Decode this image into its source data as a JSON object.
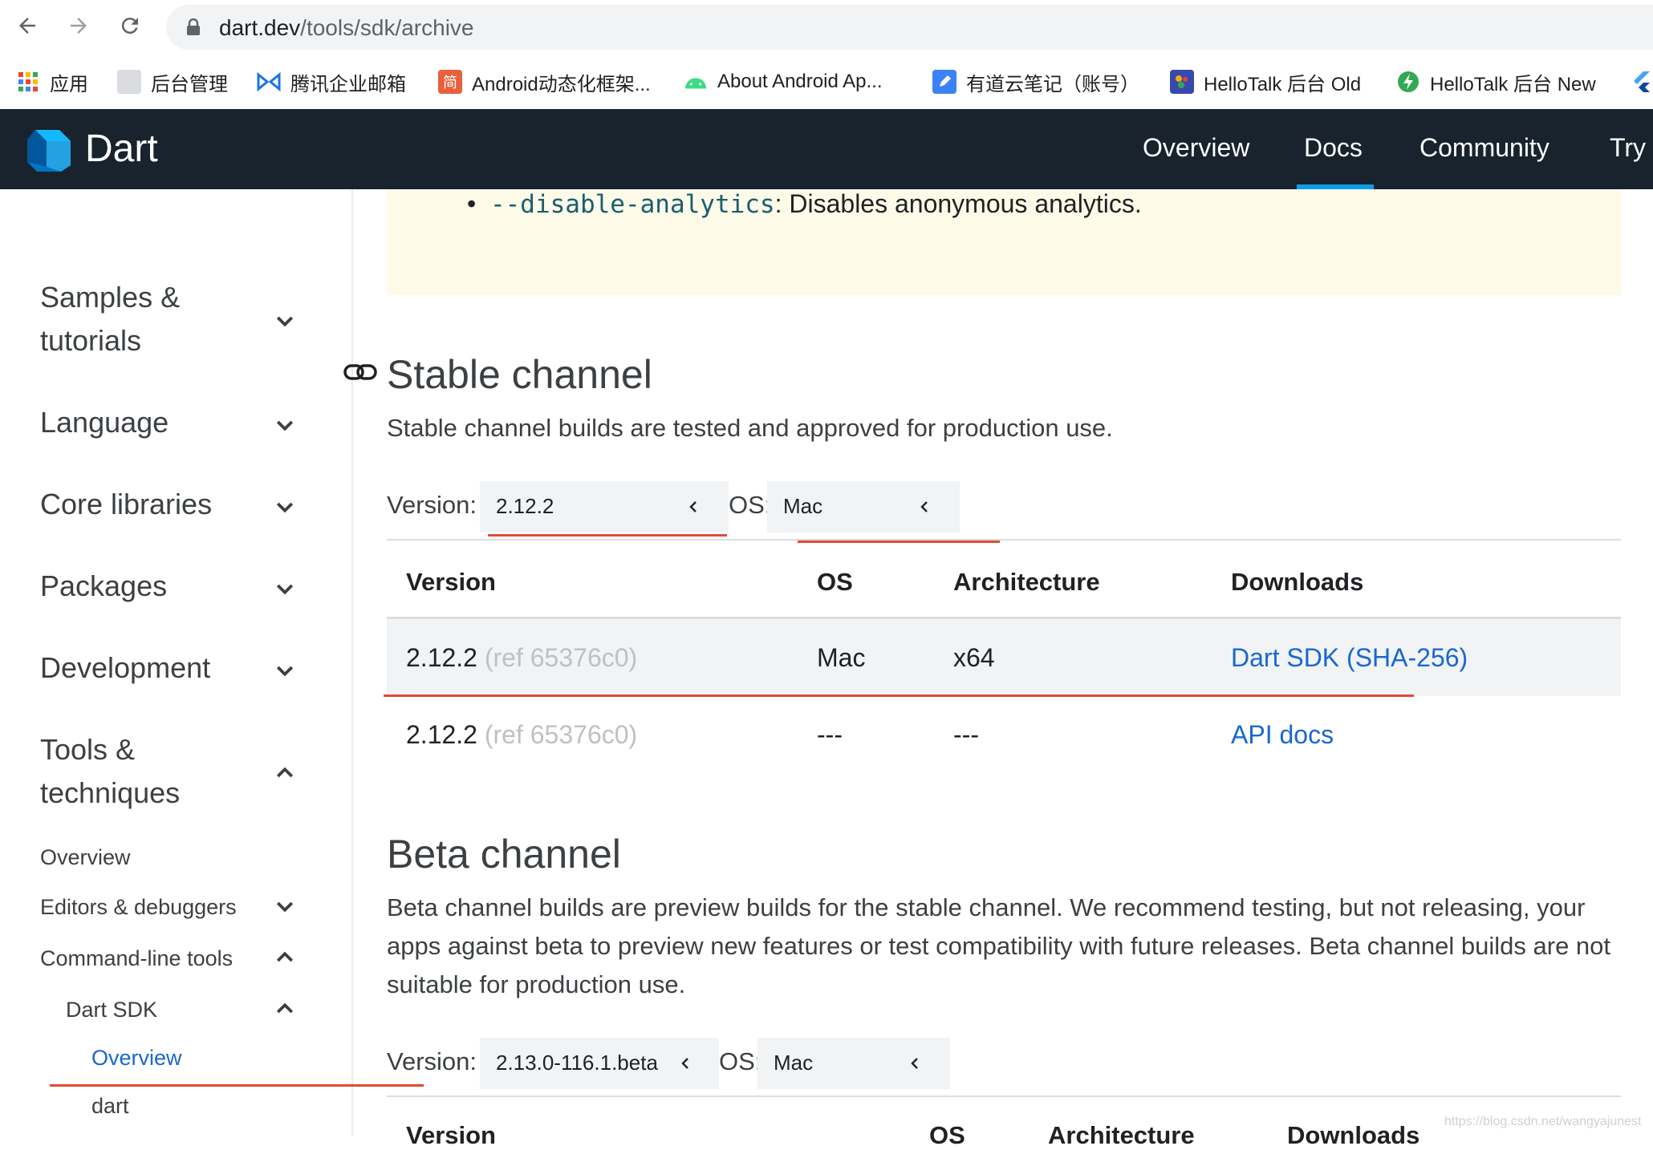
{
  "browser": {
    "url_host": "dart.dev",
    "url_path": "/tools/sdk/archive"
  },
  "bookmarks": [
    {
      "label": "应用",
      "icon": "apps-grid-icon",
      "color": "#ea4335"
    },
    {
      "label": "后台管理",
      "icon": "admin-icon",
      "color": "#9aa0a6"
    },
    {
      "label": "腾讯企业邮箱",
      "icon": "tencent-mail-icon",
      "color": "#1a73e8"
    },
    {
      "label": "Android动态化框架...",
      "icon": "jian-icon",
      "glyph": "简",
      "color": "#e8613c"
    },
    {
      "label": "About Android Ap...",
      "icon": "android-icon",
      "color": "#3ddc84"
    },
    {
      "label": "有道云笔记（账号）",
      "icon": "youdao-icon",
      "color": "#3b82f6"
    },
    {
      "label": "HelloTalk 后台 Old",
      "icon": "hellotalk-old-icon",
      "color": "#3949ab"
    },
    {
      "label": "HelloTalk 后台 New",
      "icon": "hellotalk-new-icon",
      "color": "#34a853"
    }
  ],
  "header": {
    "brand": "Dart",
    "nav": [
      "Overview",
      "Docs",
      "Community",
      "Try"
    ],
    "active_nav": "Docs"
  },
  "sidebar": {
    "sections": [
      {
        "label": "Samples & tutorials",
        "expanded": false
      },
      {
        "label": "Language",
        "expanded": false
      },
      {
        "label": "Core libraries",
        "expanded": false
      },
      {
        "label": "Packages",
        "expanded": false
      },
      {
        "label": "Development",
        "expanded": false
      },
      {
        "label": "Tools & techniques",
        "expanded": true
      }
    ],
    "items": [
      {
        "label": "Overview"
      },
      {
        "label": "Editors & debuggers",
        "expanded": false
      },
      {
        "label": "Command-line tools",
        "expanded": true
      },
      {
        "label": "Dart SDK",
        "expanded": true
      },
      {
        "label": "Overview",
        "active": true
      },
      {
        "label": "dart"
      }
    ]
  },
  "note": {
    "code": "--disable-analytics",
    "text": ": Disables anonymous analytics."
  },
  "stable": {
    "title": "Stable channel",
    "desc": "Stable channel builds are tested and approved for production use.",
    "version_label": "Version:",
    "version_value": "2.12.2",
    "os_label": "OS:",
    "os_value": "Mac",
    "columns": [
      "Version",
      "OS",
      "Architecture",
      "Downloads"
    ],
    "rows": [
      {
        "version": "2.12.2",
        "ref": "(ref 65376c0)",
        "os": "Mac",
        "arch": "x64",
        "download": "Dart SDK (SHA-256)"
      },
      {
        "version": "2.12.2",
        "ref": "(ref 65376c0)",
        "os": "---",
        "arch": "---",
        "download": "API docs"
      }
    ]
  },
  "beta": {
    "title": "Beta channel",
    "desc": "Beta channel builds are preview builds for the stable channel. We recommend testing, but not releasing, your apps against beta to preview new features or test compatibility with future releases. Beta channel builds are not suitable for production use.",
    "version_label": "Version:",
    "version_value": "2.13.0-116.1.beta",
    "os_label": "OS:",
    "os_value": "Mac",
    "columns": [
      "Version",
      "OS",
      "Architecture",
      "Downloads"
    ]
  },
  "watermark": "https://blog.csdn.net/wangyajunest",
  "colors": {
    "header_bg": "#18232d",
    "accent": "#0d9de6",
    "link": "#1967d2",
    "annotation_red": "#e24a33",
    "note_bg": "#fdfae7"
  }
}
